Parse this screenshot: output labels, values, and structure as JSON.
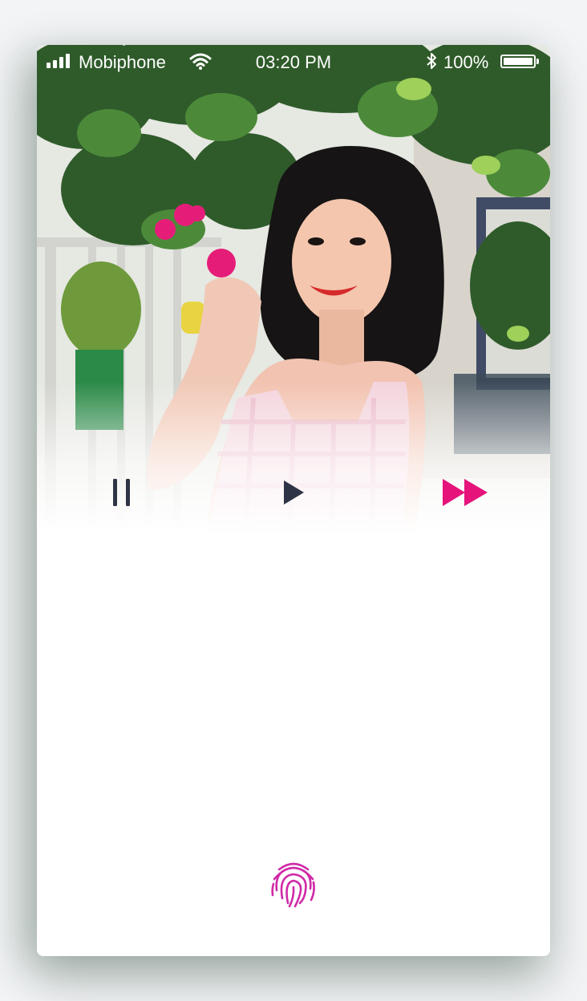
{
  "status_bar": {
    "carrier": "Mobiphone",
    "time": "03:20 PM",
    "battery": "100%",
    "signal_icon": "signal-bars-icon",
    "wifi_icon": "wifi-icon",
    "bluetooth_icon": "bluetooth-icon",
    "battery_icon": "battery-icon"
  },
  "photo": {
    "subject": "woman-with-flowers-photo"
  },
  "player": {
    "pause_icon": "pause-icon",
    "play_icon": "play-icon",
    "fast_forward_icon": "fast-forward-icon",
    "control_color": "#2e3446",
    "accent_color": "#e5137a"
  },
  "auth": {
    "fingerprint_icon": "fingerprint-icon",
    "fingerprint_color": "#cf2aa8"
  }
}
